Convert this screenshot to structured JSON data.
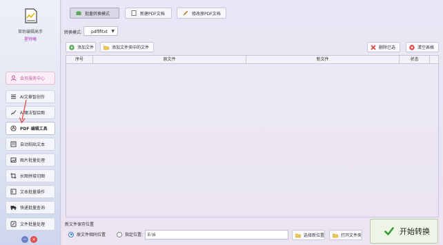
{
  "app": {
    "name": "首助编辑高手",
    "subtitle": "星特曦"
  },
  "sidebar": {
    "items": [
      {
        "label": "会员服务中心",
        "icon": "user-icon"
      },
      {
        "label": "AI文章智创作",
        "icon": "list-icon"
      },
      {
        "label": "AI魔法智绘图",
        "icon": "brush-icon"
      },
      {
        "label": "PDF 编辑工具",
        "icon": "pdf-icon"
      },
      {
        "label": "自动粘贴文本",
        "icon": "paste-icon"
      },
      {
        "label": "图片批量处理",
        "icon": "image-icon"
      },
      {
        "label": "长图拼接切图",
        "icon": "crop-icon"
      },
      {
        "label": "文本批量操作",
        "icon": "text-icon"
      },
      {
        "label": "快递批量查询",
        "icon": "truck-icon"
      },
      {
        "label": "文件批量处理",
        "icon": "file-edit-icon"
      }
    ]
  },
  "tabs": [
    {
      "label": "批量转换模式",
      "icon": "convert-icon"
    },
    {
      "label": "新建PDF文档",
      "icon": "new-doc-icon"
    },
    {
      "label": "修改原PDF文档",
      "icon": "edit-pen-icon"
    }
  ],
  "mode": {
    "label": "转换模式:",
    "value": "pdf转txt"
  },
  "toolbar": {
    "add_file": "添加文件",
    "add_folder": "添加文件夹中的文件",
    "delete_selected": "删除已选",
    "clear_table": "清空表格"
  },
  "table": {
    "columns": [
      "序号",
      "原文件",
      "新文件",
      "状态"
    ],
    "rows": []
  },
  "output": {
    "section_label": "新文件保存位置",
    "option_same": "原文件相同位置",
    "option_custom": "指定位置:",
    "path": "E:\\6",
    "choose_button": "选择新位置",
    "open_button": "打开文件夹"
  },
  "start_button": "开始转换"
}
